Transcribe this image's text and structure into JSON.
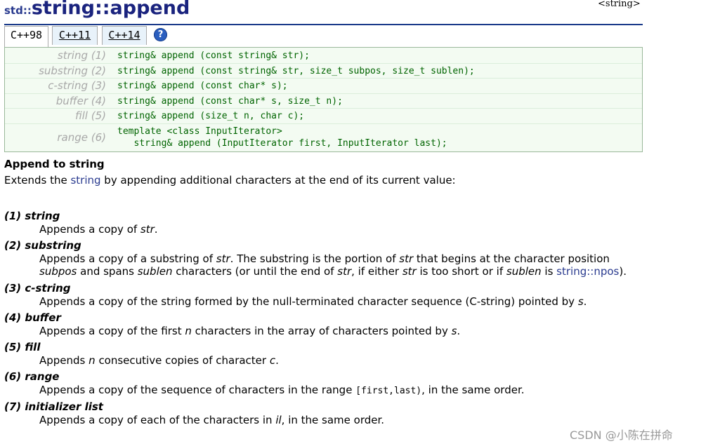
{
  "page": {
    "namespace": "std::",
    "name": "string::append",
    "header_tag": "<string>"
  },
  "tabs": [
    {
      "label": "C++98",
      "active": true
    },
    {
      "label": "C++11",
      "active": false
    },
    {
      "label": "C++14",
      "active": false
    }
  ],
  "help_icon_glyph": "?",
  "prototypes": [
    {
      "label": "string (1)",
      "code": "string& append (const string& str);"
    },
    {
      "label": "substring (2)",
      "code": "string& append (const string& str, size_t subpos, size_t sublen);"
    },
    {
      "label": "c-string (3)",
      "code": "string& append (const char* s);"
    },
    {
      "label": "buffer (4)",
      "code": "string& append (const char* s, size_t n);"
    },
    {
      "label": "fill (5)",
      "code": "string& append (size_t n, char c);"
    },
    {
      "label": "range (6)",
      "code": "template <class InputIterator>\n   string& append (InputIterator first, InputIterator last);"
    }
  ],
  "section": {
    "title": "Append to string",
    "desc_before": "Extends the ",
    "desc_link": "string",
    "desc_after": " by appending additional characters at the end of its current value:"
  },
  "items": [
    {
      "head": "(1) string",
      "l1a": "Appends a copy of ",
      "l1b": "str",
      "l1c": "."
    },
    {
      "head": "(2) substring",
      "l1a": "Appends a copy of a substring of ",
      "l1b": "str",
      "l1c": ". The substring is the portion of ",
      "l1d": "str",
      "l1e": " that begins at the character position",
      "l2a": "subpos",
      "l2b": " and spans ",
      "l2c": "sublen",
      "l2d": " characters (or until the end of ",
      "l2e": "str",
      "l2f": ", if either ",
      "l2g": "str",
      "l2h": " is too short or if ",
      "l2i": "sublen",
      "l2j": " is ",
      "l2k": "string::npos",
      "l2l": ")."
    },
    {
      "head": "(3) c-string",
      "l1a": "Appends a copy of the string formed by the null-terminated character sequence (C-string) pointed by ",
      "l1b": "s",
      "l1c": "."
    },
    {
      "head": "(4) buffer",
      "l1a": "Appends a copy of the first ",
      "l1b": "n",
      "l1c": " characters in the array of characters pointed by ",
      "l1d": "s",
      "l1e": "."
    },
    {
      "head": "(5) fill",
      "l1a": "Appends ",
      "l1b": "n",
      "l1c": " consecutive copies of character ",
      "l1d": "c",
      "l1e": "."
    },
    {
      "head": "(6) range",
      "l1a": "Appends a copy of the sequence of characters in the range ",
      "l1b": "[first,last)",
      "l1c": ", in the same order."
    },
    {
      "head": "(7) initializer list",
      "l1a": "Appends a copy of each of the characters in ",
      "l1b": "il",
      "l1c": ", in the same order."
    }
  ],
  "watermark": "CSDN @小陈在拼命"
}
